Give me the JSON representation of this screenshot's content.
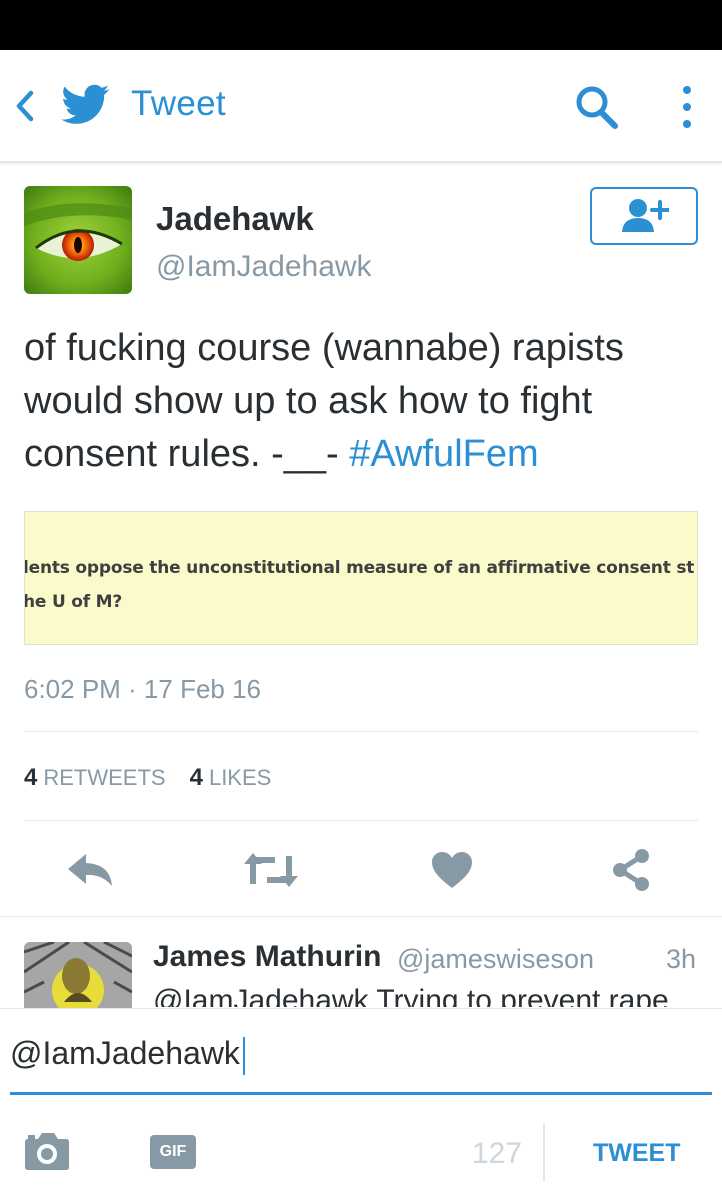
{
  "header": {
    "title": "Tweet",
    "back_icon": "chevron-left-icon",
    "logo_icon": "twitter-bird-icon",
    "search_icon": "search-icon",
    "overflow_icon": "more-vertical-icon",
    "accent_color": "#2b8fd4"
  },
  "tweet": {
    "author_name": "Jadehawk",
    "author_handle": "@IamJadehawk",
    "follow_icon": "add-user-icon",
    "text_body": "of fucking course (wannabe) rapists would show up to ask how to fight consent rules. -__- ",
    "hashtag": "#AwfulFem",
    "media": {
      "line1": "lents oppose the unconstitutional measure of an affirmative consent st",
      "line2": "he U of M?",
      "background": "#fbfacb"
    },
    "timestamp": "6:02 PM · 17 Feb 16",
    "retweets_count": "4",
    "retweets_label": "RETWEETS",
    "likes_count": "4",
    "likes_label": "LIKES",
    "actions": [
      "reply-icon",
      "retweet-icon",
      "heart-icon",
      "share-icon"
    ]
  },
  "reply": {
    "author_name": "James Mathurin",
    "author_handle": "@jameswiseson",
    "time": "3h",
    "text": "@IamJadehawk Trying to prevent rape"
  },
  "compose": {
    "input_value": "@IamJadehawk",
    "camera_icon": "camera-icon",
    "gif_label": "GIF",
    "char_count": "127",
    "submit_label": "TWEET"
  }
}
